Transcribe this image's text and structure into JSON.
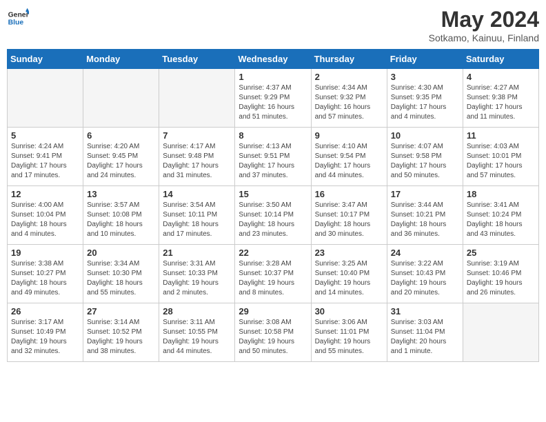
{
  "logo": {
    "line1": "General",
    "line2": "Blue"
  },
  "title": "May 2024",
  "subtitle": "Sotkamo, Kainuu, Finland",
  "days_of_week": [
    "Sunday",
    "Monday",
    "Tuesday",
    "Wednesday",
    "Thursday",
    "Friday",
    "Saturday"
  ],
  "weeks": [
    [
      {
        "day": "",
        "info": "",
        "empty": true
      },
      {
        "day": "",
        "info": "",
        "empty": true
      },
      {
        "day": "",
        "info": "",
        "empty": true
      },
      {
        "day": "1",
        "info": "Sunrise: 4:37 AM\nSunset: 9:29 PM\nDaylight: 16 hours\nand 51 minutes.",
        "empty": false
      },
      {
        "day": "2",
        "info": "Sunrise: 4:34 AM\nSunset: 9:32 PM\nDaylight: 16 hours\nand 57 minutes.",
        "empty": false
      },
      {
        "day": "3",
        "info": "Sunrise: 4:30 AM\nSunset: 9:35 PM\nDaylight: 17 hours\nand 4 minutes.",
        "empty": false
      },
      {
        "day": "4",
        "info": "Sunrise: 4:27 AM\nSunset: 9:38 PM\nDaylight: 17 hours\nand 11 minutes.",
        "empty": false
      }
    ],
    [
      {
        "day": "5",
        "info": "Sunrise: 4:24 AM\nSunset: 9:41 PM\nDaylight: 17 hours\nand 17 minutes.",
        "empty": false
      },
      {
        "day": "6",
        "info": "Sunrise: 4:20 AM\nSunset: 9:45 PM\nDaylight: 17 hours\nand 24 minutes.",
        "empty": false
      },
      {
        "day": "7",
        "info": "Sunrise: 4:17 AM\nSunset: 9:48 PM\nDaylight: 17 hours\nand 31 minutes.",
        "empty": false
      },
      {
        "day": "8",
        "info": "Sunrise: 4:13 AM\nSunset: 9:51 PM\nDaylight: 17 hours\nand 37 minutes.",
        "empty": false
      },
      {
        "day": "9",
        "info": "Sunrise: 4:10 AM\nSunset: 9:54 PM\nDaylight: 17 hours\nand 44 minutes.",
        "empty": false
      },
      {
        "day": "10",
        "info": "Sunrise: 4:07 AM\nSunset: 9:58 PM\nDaylight: 17 hours\nand 50 minutes.",
        "empty": false
      },
      {
        "day": "11",
        "info": "Sunrise: 4:03 AM\nSunset: 10:01 PM\nDaylight: 17 hours\nand 57 minutes.",
        "empty": false
      }
    ],
    [
      {
        "day": "12",
        "info": "Sunrise: 4:00 AM\nSunset: 10:04 PM\nDaylight: 18 hours\nand 4 minutes.",
        "empty": false
      },
      {
        "day": "13",
        "info": "Sunrise: 3:57 AM\nSunset: 10:08 PM\nDaylight: 18 hours\nand 10 minutes.",
        "empty": false
      },
      {
        "day": "14",
        "info": "Sunrise: 3:54 AM\nSunset: 10:11 PM\nDaylight: 18 hours\nand 17 minutes.",
        "empty": false
      },
      {
        "day": "15",
        "info": "Sunrise: 3:50 AM\nSunset: 10:14 PM\nDaylight: 18 hours\nand 23 minutes.",
        "empty": false
      },
      {
        "day": "16",
        "info": "Sunrise: 3:47 AM\nSunset: 10:17 PM\nDaylight: 18 hours\nand 30 minutes.",
        "empty": false
      },
      {
        "day": "17",
        "info": "Sunrise: 3:44 AM\nSunset: 10:21 PM\nDaylight: 18 hours\nand 36 minutes.",
        "empty": false
      },
      {
        "day": "18",
        "info": "Sunrise: 3:41 AM\nSunset: 10:24 PM\nDaylight: 18 hours\nand 43 minutes.",
        "empty": false
      }
    ],
    [
      {
        "day": "19",
        "info": "Sunrise: 3:38 AM\nSunset: 10:27 PM\nDaylight: 18 hours\nand 49 minutes.",
        "empty": false
      },
      {
        "day": "20",
        "info": "Sunrise: 3:34 AM\nSunset: 10:30 PM\nDaylight: 18 hours\nand 55 minutes.",
        "empty": false
      },
      {
        "day": "21",
        "info": "Sunrise: 3:31 AM\nSunset: 10:33 PM\nDaylight: 19 hours\nand 2 minutes.",
        "empty": false
      },
      {
        "day": "22",
        "info": "Sunrise: 3:28 AM\nSunset: 10:37 PM\nDaylight: 19 hours\nand 8 minutes.",
        "empty": false
      },
      {
        "day": "23",
        "info": "Sunrise: 3:25 AM\nSunset: 10:40 PM\nDaylight: 19 hours\nand 14 minutes.",
        "empty": false
      },
      {
        "day": "24",
        "info": "Sunrise: 3:22 AM\nSunset: 10:43 PM\nDaylight: 19 hours\nand 20 minutes.",
        "empty": false
      },
      {
        "day": "25",
        "info": "Sunrise: 3:19 AM\nSunset: 10:46 PM\nDaylight: 19 hours\nand 26 minutes.",
        "empty": false
      }
    ],
    [
      {
        "day": "26",
        "info": "Sunrise: 3:17 AM\nSunset: 10:49 PM\nDaylight: 19 hours\nand 32 minutes.",
        "empty": false
      },
      {
        "day": "27",
        "info": "Sunrise: 3:14 AM\nSunset: 10:52 PM\nDaylight: 19 hours\nand 38 minutes.",
        "empty": false
      },
      {
        "day": "28",
        "info": "Sunrise: 3:11 AM\nSunset: 10:55 PM\nDaylight: 19 hours\nand 44 minutes.",
        "empty": false
      },
      {
        "day": "29",
        "info": "Sunrise: 3:08 AM\nSunset: 10:58 PM\nDaylight: 19 hours\nand 50 minutes.",
        "empty": false
      },
      {
        "day": "30",
        "info": "Sunrise: 3:06 AM\nSunset: 11:01 PM\nDaylight: 19 hours\nand 55 minutes.",
        "empty": false
      },
      {
        "day": "31",
        "info": "Sunrise: 3:03 AM\nSunset: 11:04 PM\nDaylight: 20 hours\nand 1 minute.",
        "empty": false
      },
      {
        "day": "",
        "info": "",
        "empty": true
      }
    ]
  ]
}
